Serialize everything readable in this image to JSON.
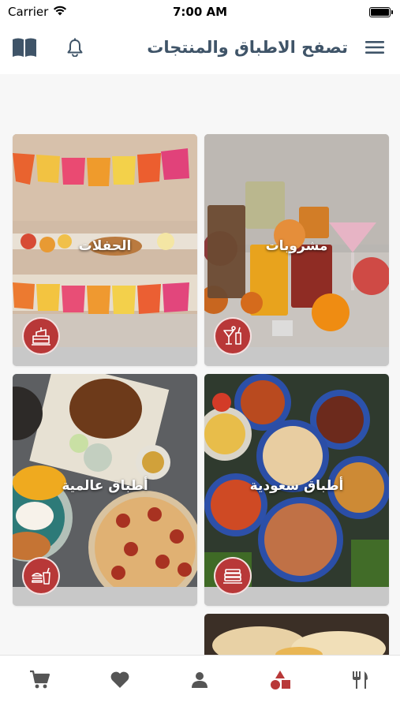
{
  "status_bar": {
    "carrier": "Carrier",
    "time": "7:00 AM"
  },
  "header": {
    "title": "تصفح الاطباق والمنتجات",
    "title_color": "#3f5468"
  },
  "categories": [
    {
      "label": "مشروبات",
      "icon": "cocktail-icon"
    },
    {
      "label": "الحفلات",
      "icon": "cake-icon"
    },
    {
      "label": "أطباق سعودية",
      "icon": "pancake-stack-icon"
    },
    {
      "label": "أطباق عالمية",
      "icon": "fast-food-icon"
    }
  ],
  "tabbar": {
    "items": [
      {
        "icon": "cart-icon",
        "active": false
      },
      {
        "icon": "heart-icon",
        "active": false
      },
      {
        "icon": "profile-icon",
        "active": false
      },
      {
        "icon": "categories-shapes-icon",
        "active": true
      },
      {
        "icon": "fork-knife-icon",
        "active": false
      }
    ],
    "active_color": "#b83838",
    "inactive_color": "#555555"
  },
  "colors": {
    "accent": "#b83838",
    "content_background": "#f7f7f7"
  }
}
